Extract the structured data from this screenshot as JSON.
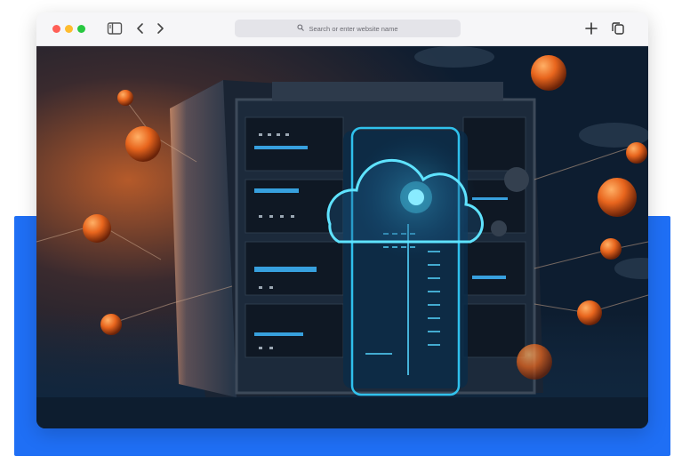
{
  "window": {
    "controls": [
      "close",
      "minimize",
      "maximize"
    ],
    "colors": {
      "close": "#ff5f57",
      "minimize": "#febc2e",
      "maximize": "#28c840"
    }
  },
  "toolbar": {
    "sidebar_icon": "sidebar-toggle-icon",
    "back_icon": "chevron-left-icon",
    "forward_icon": "chevron-right-icon",
    "new_tab_icon": "plus-icon",
    "tabs_icon": "tab-overview-icon"
  },
  "address_bar": {
    "icon": "search-icon",
    "placeholder": "Search or enter website name"
  },
  "content": {
    "image_subject": "cloud server rack illustration",
    "accent_colors": {
      "glow": "#33d1ff",
      "orb": "#e8651d",
      "background": "#1f6ff5"
    }
  }
}
